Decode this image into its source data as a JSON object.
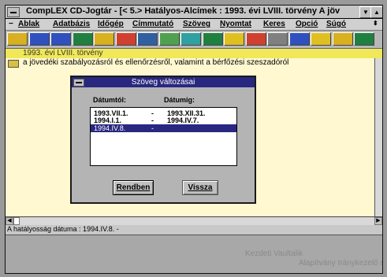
{
  "window": {
    "title": "CompLEX CD-Jogtár  - [< 5.> Hatályos-Alcímek : 1993. évi LVIII. törvény  A jöv"
  },
  "menu": [
    "Ablak",
    "Adatbázis",
    "Időgép",
    "Címmutató",
    "Szöveg",
    "Nyomtat",
    "Keres",
    "Opció",
    "Súgó"
  ],
  "toolbar": {
    "icon_colors": [
      "#d8b020",
      "#3050c0",
      "#3050c0",
      "#208040",
      "#d8b020",
      "#d04030",
      "#3060a0",
      "#50a050",
      "#30a0a0",
      "#208040",
      "#e0c020",
      "#d04030",
      "#808080",
      "#3050c0",
      "#e0c020",
      "#d8b020",
      "#208040"
    ]
  },
  "document": {
    "title": "1993. évi LVIII. törvény",
    "line1": "a jövedéki szabályozásról és ellenőrzésről, valamint a bérfőzési szeszadóról"
  },
  "dialog": {
    "title": "Szöveg változásai",
    "col_from": "Dátumtól:",
    "col_to": "Dátumig:",
    "rows": [
      {
        "from": "1993.VII.1.",
        "sep": "-",
        "to": "1993.XII.31."
      },
      {
        "from": "1994.I.1.",
        "sep": "-",
        "to": "1994.IV.7."
      },
      {
        "from": "1994.IV.8.",
        "sep": "-",
        "to": ""
      }
    ],
    "selected_index": 2,
    "ok_label": "Rendben",
    "cancel_label": "Vissza"
  },
  "status": {
    "text": "A hatályosság dátuma : 1994.IV.8. -"
  },
  "bottom": {
    "ghost_left": "Kezdeti Vaultalik",
    "ghost_right": "Alapítvány Iránykezelő szerveinek"
  }
}
